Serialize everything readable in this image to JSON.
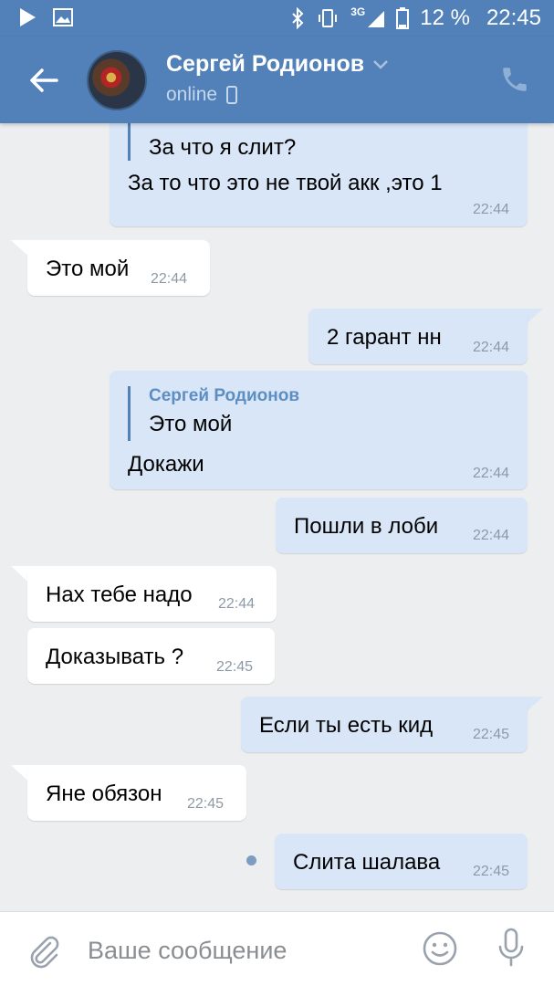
{
  "status_bar": {
    "network": "3G",
    "battery": "12 %",
    "time": "22:45"
  },
  "header": {
    "contact_name": "Сергей Родионов",
    "status": "online"
  },
  "messages": [
    {
      "quote_text": "За что я слит?",
      "text": "За то что это не твой акк ,это 1",
      "time": "22:44"
    },
    {
      "text": "Это мой",
      "time": "22:44"
    },
    {
      "text": "2 гарант нн",
      "time": "22:44"
    },
    {
      "quote_name": "Сергей Родионов",
      "quote_text": "Это мой",
      "text": "Докажи",
      "time": "22:44"
    },
    {
      "text": "Пошли в лоби",
      "time": "22:44"
    },
    {
      "text": "Нах тебе надо",
      "time": "22:44"
    },
    {
      "text": "Доказывать ?",
      "time": "22:45"
    },
    {
      "text": "Если ты есть кид",
      "time": "22:45"
    },
    {
      "text": "Яне обязон",
      "time": "22:45"
    },
    {
      "text": "Слита шалава",
      "time": "22:45"
    }
  ],
  "composer": {
    "placeholder": "Ваше сообщение"
  },
  "icons": {
    "back": "arrow-left-icon",
    "call": "phone-icon",
    "attach": "paperclip-icon",
    "emoji": "smiley-icon",
    "voice": "microphone-icon",
    "dropdown": "chevron-down-icon"
  },
  "colors": {
    "header": "#5181b8",
    "outgoing_bubble": "#d8e6f8",
    "incoming_bubble": "#ffffff",
    "background": "#edeef0"
  }
}
